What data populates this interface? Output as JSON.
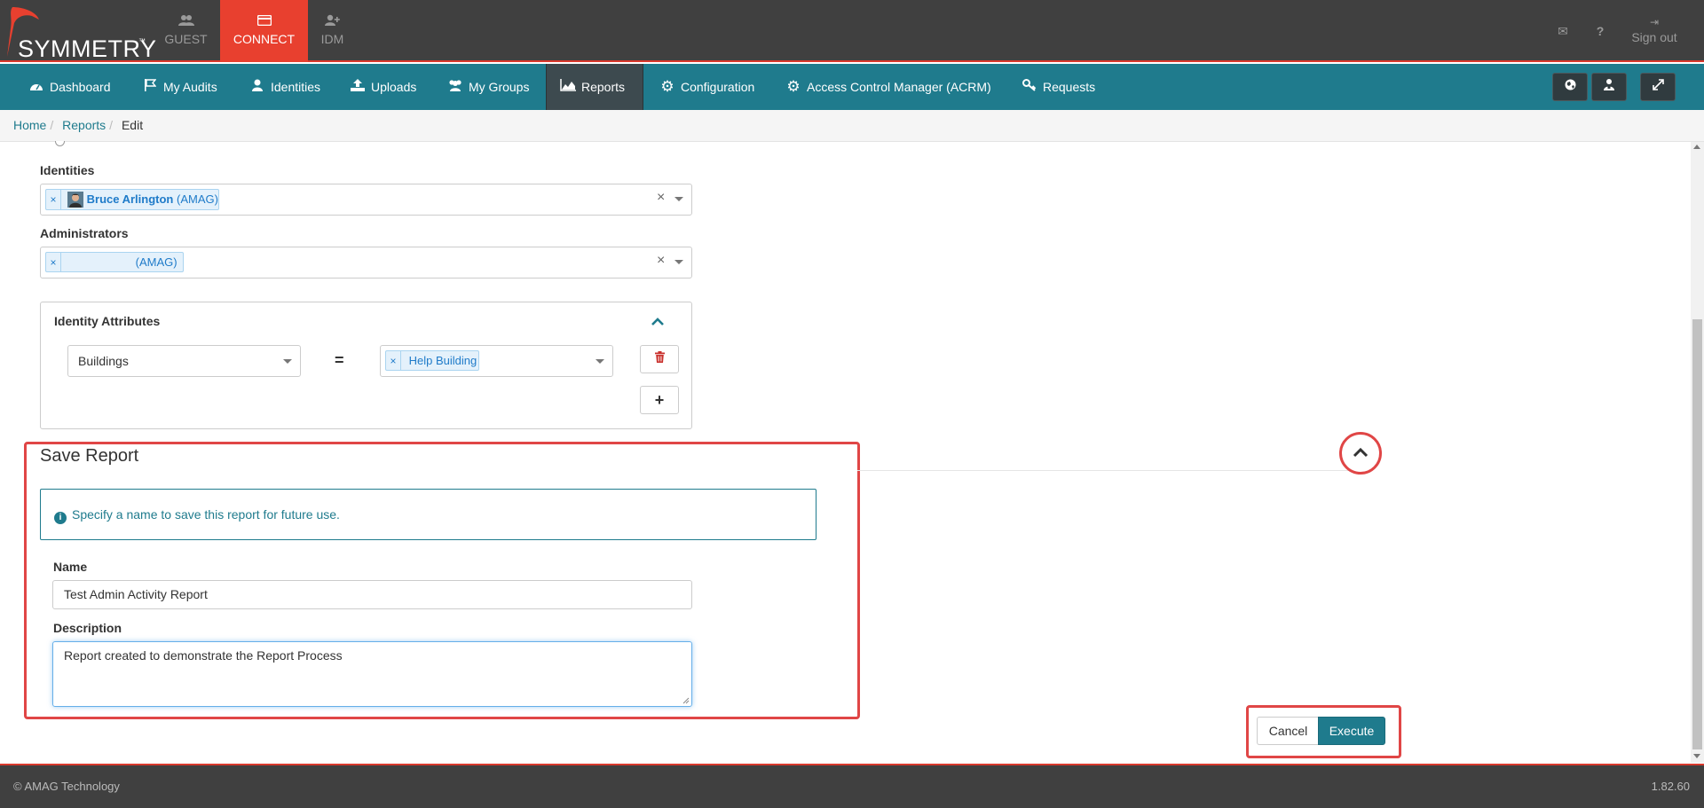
{
  "brand": {
    "logo_text": "SYMMETRY",
    "tm": "™"
  },
  "top_tabs": [
    {
      "label": "GUEST",
      "icon": "users-icon"
    },
    {
      "label": "CONNECT",
      "icon": "card-icon",
      "active": true
    },
    {
      "label": "IDM",
      "icon": "user-plus-icon"
    }
  ],
  "top_right": {
    "mail_icon": "✉",
    "help_icon": "?",
    "signout_label": "Sign out"
  },
  "nav": {
    "items": [
      {
        "label": "Dashboard",
        "icon": "dashboard-icon"
      },
      {
        "label": "My Audits",
        "icon": "flag-icon"
      },
      {
        "label": "Identities",
        "icon": "user-icon"
      },
      {
        "label": "Uploads",
        "icon": "upload-icon"
      },
      {
        "label": "My Groups",
        "icon": "group-icon"
      },
      {
        "label": "Reports",
        "icon": "area-chart-icon",
        "active": true
      },
      {
        "label": "Configuration",
        "icon": "gear-icon"
      },
      {
        "label": "Access Control Manager (ACRM)",
        "icon": "gear-icon"
      },
      {
        "label": "Requests",
        "icon": "key-icon"
      }
    ]
  },
  "breadcrumb": {
    "home": "Home",
    "reports": "Reports",
    "current": "Edit"
  },
  "form": {
    "identities_label": "Identities",
    "identity_tag_name": "Bruce Arlington",
    "identity_tag_org": "(AMAG)",
    "administrators_label": "Administrators",
    "admin_tag_org": "(AMAG)",
    "attributes": {
      "title": "Identity Attributes",
      "attribute_select": "Buildings",
      "operator": "=",
      "value_tag": "Help Building"
    }
  },
  "save_report": {
    "title": "Save Report",
    "info_text": "Specify a name to save this report for future use.",
    "name_label": "Name",
    "name_value": "Test Admin Activity Report",
    "description_label": "Description",
    "description_value": "Report created to demonstrate the Report Process"
  },
  "actions": {
    "cancel_label": "Cancel",
    "execute_label": "Execute"
  },
  "footer": {
    "copyright": "© AMAG Technology",
    "version": "1.82.60"
  },
  "colors": {
    "accent": "#1f7b8d",
    "brand_red": "#e8402f",
    "highlight": "#e04646",
    "topbar": "#404040"
  }
}
